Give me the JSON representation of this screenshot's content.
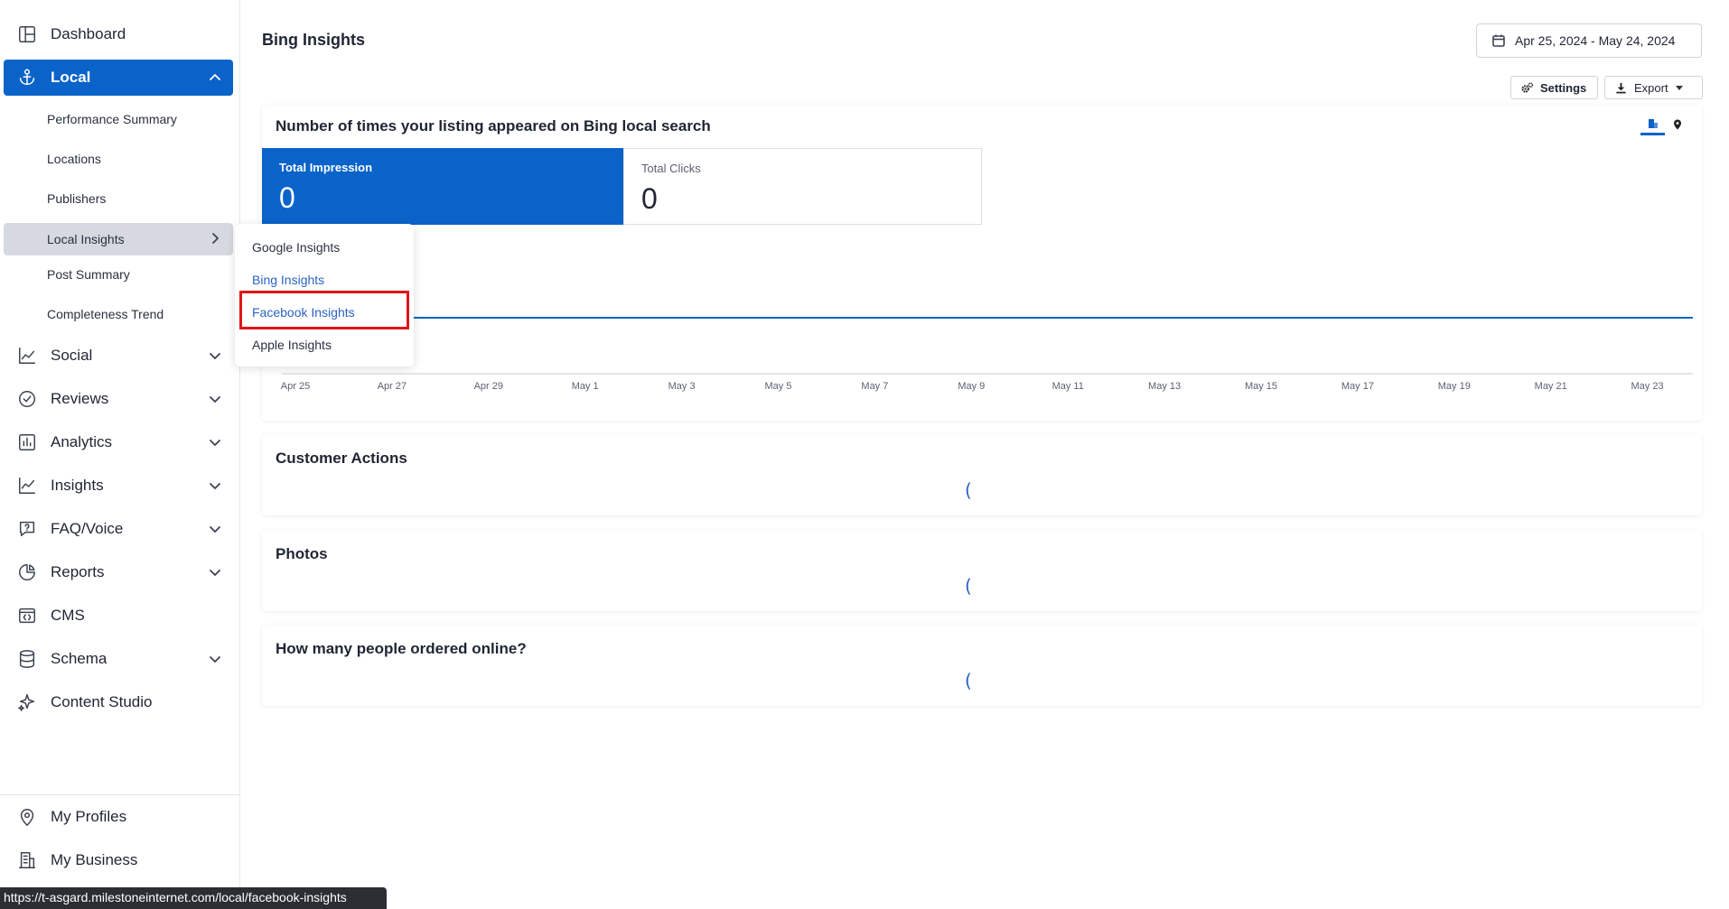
{
  "sidebar": {
    "items": [
      {
        "label": "Dashboard",
        "icon": "dashboard-icon"
      },
      {
        "label": "Local",
        "icon": "anchor-icon"
      },
      {
        "label": "Social",
        "icon": "line-chart-icon"
      },
      {
        "label": "Reviews",
        "icon": "check-circle-icon"
      },
      {
        "label": "Analytics",
        "icon": "bar-chart-icon"
      },
      {
        "label": "Insights",
        "icon": "trend-chart-icon"
      },
      {
        "label": "FAQ/Voice",
        "icon": "faq-icon"
      },
      {
        "label": "Reports",
        "icon": "pie-chart-icon"
      },
      {
        "label": "CMS",
        "icon": "code-window-icon"
      },
      {
        "label": "Schema",
        "icon": "database-icon"
      },
      {
        "label": "Content Studio",
        "icon": "sparkle-icon"
      }
    ],
    "local_sub": [
      "Performance Summary",
      "Locations",
      "Publishers",
      "Local Insights",
      "Post Summary",
      "Completeness Trend"
    ],
    "bottom": [
      {
        "label": "My Profiles",
        "icon": "location-pin-icon"
      },
      {
        "label": "My Business",
        "icon": "building-icon"
      }
    ]
  },
  "flyout": {
    "items": [
      "Google Insights",
      "Bing Insights",
      "Facebook Insights",
      "Apple Insights"
    ]
  },
  "header": {
    "title": "Bing Insights",
    "date_range": "Apr 25, 2024 - May 24, 2024",
    "settings_label": "Settings",
    "export_label": "Export"
  },
  "impressions": {
    "title": "Number of times your listing appeared on Bing local search",
    "metrics": [
      {
        "label": "Total Impression",
        "value": "0"
      },
      {
        "label": "Total Clicks",
        "value": "0"
      }
    ]
  },
  "chart_data": {
    "type": "line",
    "x": [
      "Apr 25",
      "Apr 27",
      "Apr 29",
      "May 1",
      "May 3",
      "May 5",
      "May 7",
      "May 9",
      "May 11",
      "May 13",
      "May 15",
      "May 17",
      "May 19",
      "May 21",
      "May 23"
    ],
    "series": [
      {
        "values": [
          0,
          0,
          0,
          0,
          0,
          0,
          0,
          0,
          0,
          0,
          0,
          0,
          0,
          0,
          0
        ]
      }
    ],
    "title": "",
    "xlabel": "",
    "ylabel": "",
    "color": "#0a63c9"
  },
  "sections": [
    {
      "title": "Customer Actions",
      "spinner": "("
    },
    {
      "title": "Photos",
      "spinner": "("
    },
    {
      "title": "How many people ordered online?",
      "spinner": "("
    }
  ],
  "status_bar": {
    "url": "https://t-asgard.milestoneinternet.com/local/facebook-insights"
  },
  "colors": {
    "primary": "#0a63c9",
    "link": "#2a63c4",
    "highlight": "#e01515"
  }
}
